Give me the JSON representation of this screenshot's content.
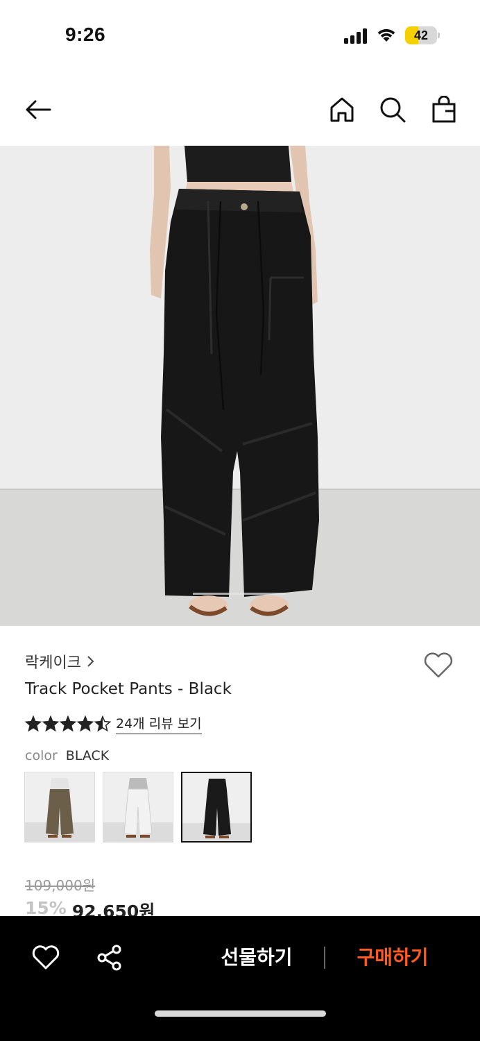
{
  "status_bar": {
    "time": "9:26",
    "battery_level": "42",
    "battery_fraction": 0.42,
    "accent": "#f5d000"
  },
  "nav": {
    "icons": [
      "back-arrow-icon",
      "home-icon",
      "search-icon",
      "shopping-bag-icon"
    ]
  },
  "product": {
    "brand": "락케이크",
    "title": "Track Pocket Pants - Black",
    "rating": 4.5,
    "review_link": "24개 리뷰 보기",
    "color_label": "color",
    "color_value": "BLACK",
    "swatches": [
      {
        "name": "khaki",
        "color": "#6b5f4a"
      },
      {
        "name": "white",
        "color": "#f2f2f2"
      },
      {
        "name": "black",
        "color": "#1a1a1a",
        "selected": true
      }
    ],
    "original_price": "109,000원",
    "discount": "15%",
    "final_price": "92,650원"
  },
  "bottom_bar": {
    "gift_label": "선물하기",
    "buy_label": "구매하기",
    "buy_color": "#ff5a1f"
  }
}
